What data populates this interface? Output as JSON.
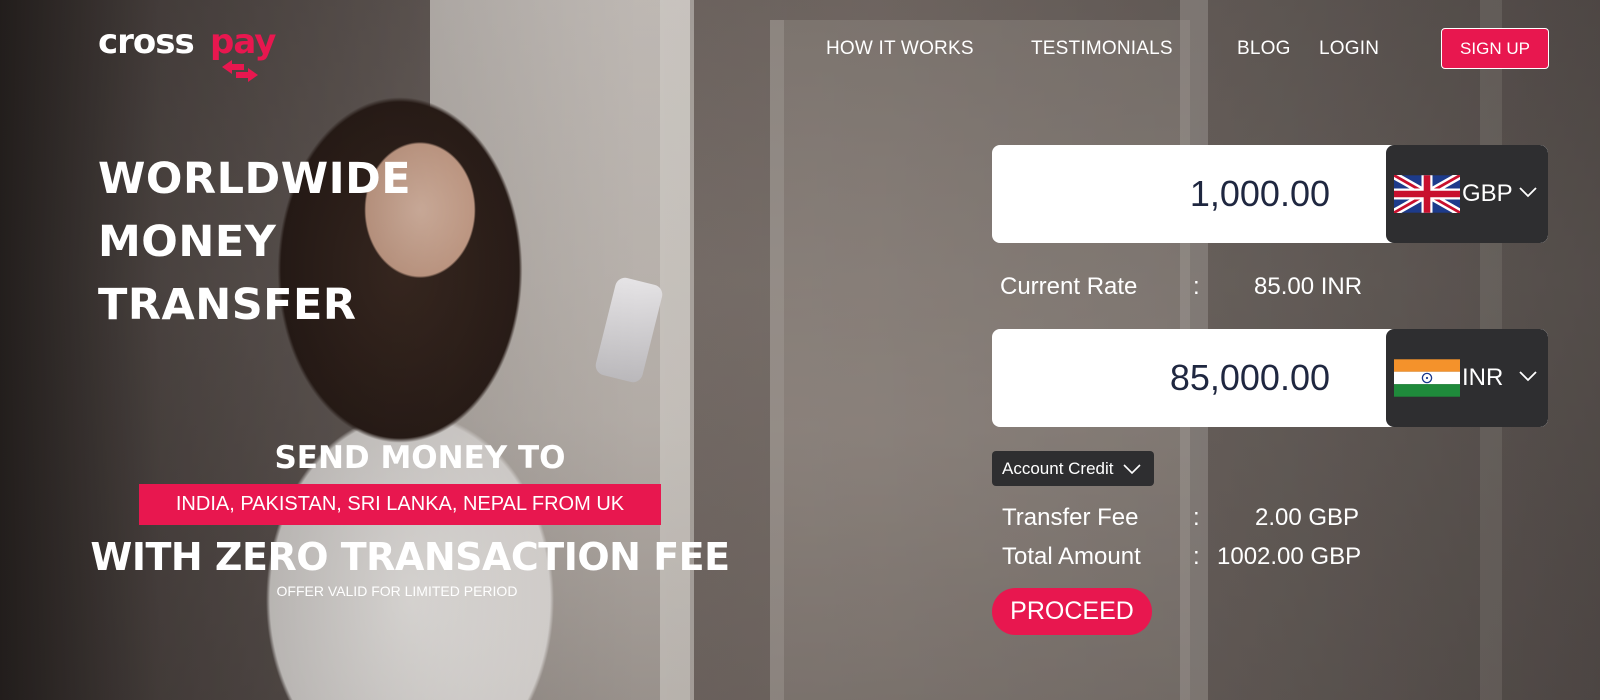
{
  "brand": {
    "logo_part1": "cross",
    "logo_part2": "pay",
    "accent_color": "#e8174f"
  },
  "nav": {
    "items": [
      {
        "label": "HOW IT WORKS"
      },
      {
        "label": "TESTIMONIALS"
      },
      {
        "label": "BLOG"
      },
      {
        "label": "LOGIN"
      }
    ],
    "signup_label": "SIGN UP"
  },
  "hero": {
    "title_lines": [
      "WORLDWIDE",
      "MONEY",
      "TRANSFER"
    ]
  },
  "promo": {
    "send_text": "SEND MONEY TO",
    "countries_text": "INDIA, PAKISTAN, SRI LANKA, NEPAL FROM UK",
    "zero_fee_text": "WITH ZERO TRANSACTION FEE",
    "offer_text": "OFFER VALID FOR LIMITED PERIOD"
  },
  "converter": {
    "send_amount": "1,000.00",
    "send_currency": "GBP",
    "send_flag_icon": "uk-flag-icon",
    "rate_label": "Current Rate",
    "rate_separator": ":",
    "rate_value": "85.00 INR",
    "receive_amount": "85,000.00",
    "receive_currency": "INR",
    "receive_flag_icon": "india-flag-icon",
    "payment_method": "Account Credit",
    "transfer_fee_label": "Transfer Fee",
    "transfer_fee_value": "2.00 GBP",
    "total_label": "Total Amount",
    "total_value": "1002.00 GBP",
    "separator": ":",
    "proceed_label": "PROCEED"
  }
}
